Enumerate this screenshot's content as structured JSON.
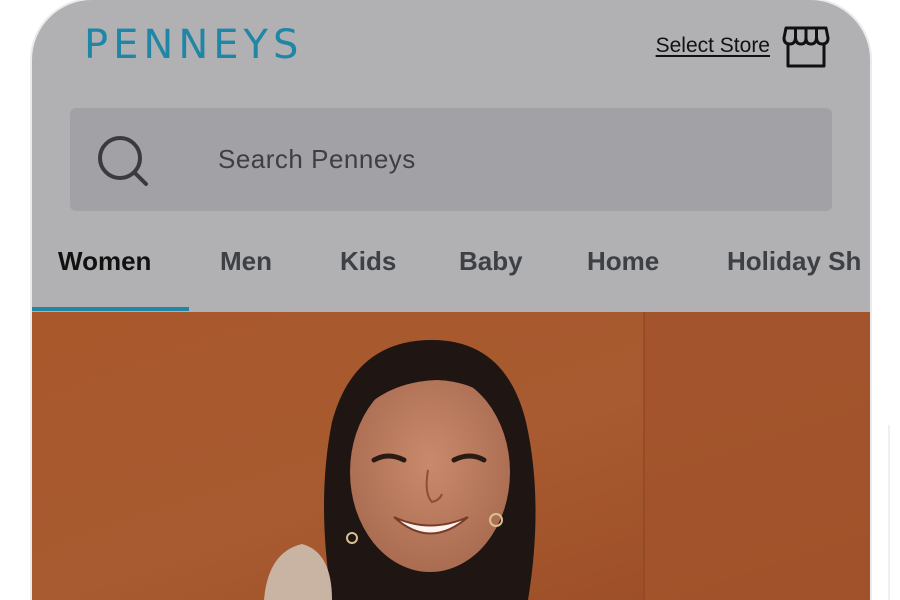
{
  "header": {
    "logo": "PENNEYS",
    "select_store_label": "Select Store",
    "store_icon": "storefront-icon"
  },
  "search": {
    "placeholder": "Search Penneys",
    "icon": "search-icon"
  },
  "tabs": [
    {
      "label": "Women",
      "active": true
    },
    {
      "label": "Men",
      "active": false
    },
    {
      "label": "Kids",
      "active": false
    },
    {
      "label": "Baby",
      "active": false
    },
    {
      "label": "Home",
      "active": false
    },
    {
      "label": "Holiday Sh",
      "active": false
    }
  ],
  "colors": {
    "brand": "#1f86a6",
    "overlay": "#b1b1b3",
    "search_bg": "#a2a2a6",
    "hero_bg": "#a4552a"
  }
}
